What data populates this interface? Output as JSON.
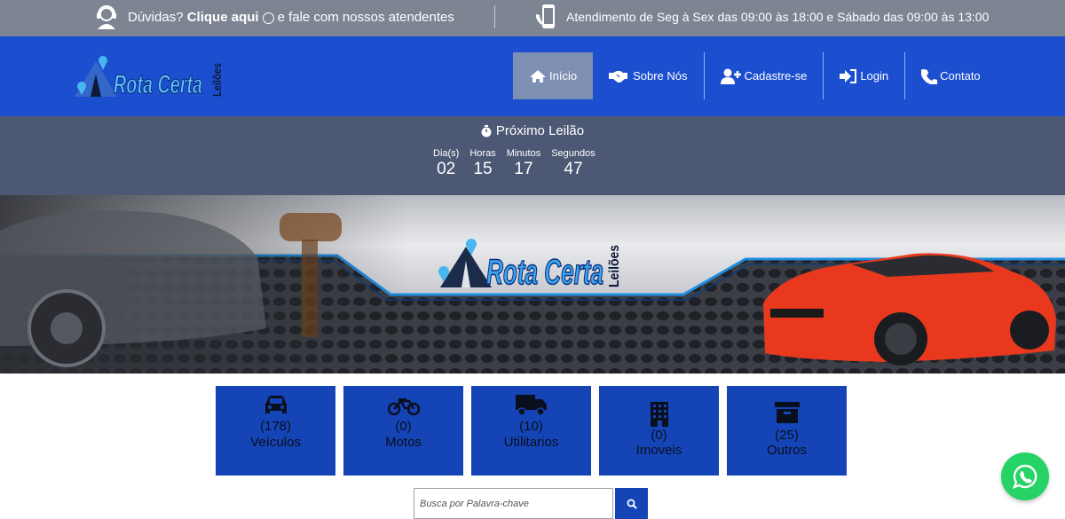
{
  "topbar": {
    "help_text_1": "Dúvidas?",
    "help_link": "Clique aqui",
    "help_text_2": "e fale com nossos atendentes",
    "hours": "Atendimento de Seg à Sex das 09:00 às 18:00 e Sábado das 09:00 às 13:00"
  },
  "header": {
    "logo": {
      "name": "Rota Certa",
      "sub": "Leilões"
    },
    "nav": [
      {
        "label": "Início",
        "icon": "home-icon",
        "active": true
      },
      {
        "label": "Sobre Nós",
        "icon": "handshake-icon"
      },
      {
        "label": "Cadastre-se",
        "icon": "user-plus-icon"
      },
      {
        "label": "Login",
        "icon": "sign-in-icon"
      },
      {
        "label": "Contato",
        "icon": "phone-icon"
      }
    ]
  },
  "countdown": {
    "title": "Próximo Leilão",
    "units": [
      {
        "label": "Dia(s)",
        "value": "02"
      },
      {
        "label": "Horas",
        "value": "15"
      },
      {
        "label": "Minutos",
        "value": "17"
      },
      {
        "label": "Segundos",
        "value": "47"
      }
    ]
  },
  "banner": {
    "logo_name": "Rota Certa",
    "logo_sub": "Leilões"
  },
  "categories": [
    {
      "count": "(178)",
      "label": "Veículos",
      "icon": "car-icon"
    },
    {
      "count": "(0)",
      "label": "Motos",
      "icon": "motorcycle-icon"
    },
    {
      "count": "(10)",
      "label": "Utilitarios",
      "icon": "truck-icon"
    },
    {
      "count": "(0)",
      "label": "Imoveis",
      "icon": "building-icon"
    },
    {
      "count": "(25)",
      "label": "Outros",
      "icon": "box-icon"
    }
  ],
  "search": {
    "placeholder": "Busca por Palavra-chave"
  },
  "colors": {
    "topbar": "#7d8593",
    "header": "#1c4fd0",
    "countdown": "#4d5874",
    "card": "#1444b6",
    "whatsapp": "#25d366"
  }
}
